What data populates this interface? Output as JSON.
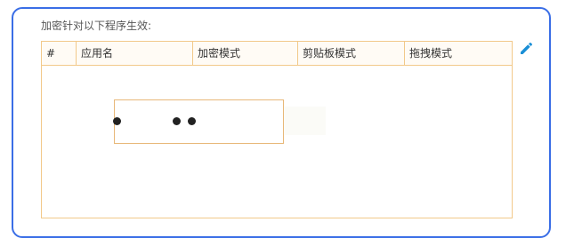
{
  "panel": {
    "title": "加密针对以下程序生效:"
  },
  "table": {
    "columns": [
      {
        "id": "index",
        "label": "#"
      },
      {
        "id": "app_name",
        "label": "应用名"
      },
      {
        "id": "encrypt_mode",
        "label": "加密模式"
      },
      {
        "id": "clipboard_mode",
        "label": "剪贴板模式"
      },
      {
        "id": "drag_mode",
        "label": "拖拽模式"
      }
    ],
    "rows": []
  },
  "icons": {
    "edit": "pencil-icon"
  },
  "colors": {
    "panel_border": "#3a6ee6",
    "table_border": "#f2c98a",
    "edit_icon": "#1a8fd6"
  }
}
